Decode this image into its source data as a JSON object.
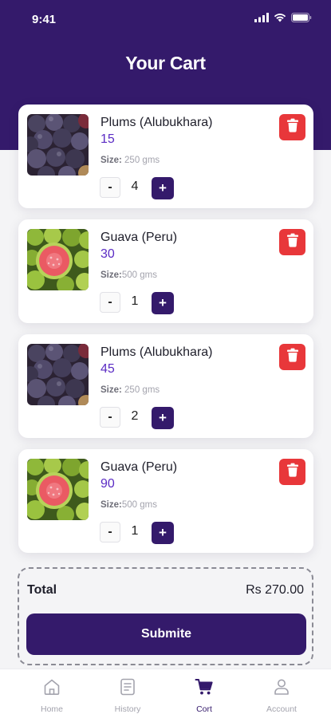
{
  "status_bar": {
    "time": "9:41"
  },
  "header": {
    "title": "Your Cart"
  },
  "cart_items": [
    {
      "name": "Plums (Alubukhara)",
      "price": "15",
      "size_label": "Size:",
      "size_value": " 250 gms",
      "quantity": "4",
      "image": "plums-image"
    },
    {
      "name": "Guava (Peru)",
      "price": "30",
      "size_label": "Size:",
      "size_value": "500 gms",
      "quantity": "1",
      "image": "guava-image"
    },
    {
      "name": "Plums (Alubukhara)",
      "price": "45",
      "size_label": "Size:",
      "size_value": " 250 gms",
      "quantity": "2",
      "image": "plums-image"
    },
    {
      "name": "Guava (Peru)",
      "price": "90",
      "size_label": "Size:",
      "size_value": "500 gms",
      "quantity": "1",
      "image": "guava-image"
    }
  ],
  "quantity_controls": {
    "minus": "-",
    "plus": "+"
  },
  "summary": {
    "total_label": "Total",
    "total_value": "Rs 270.00",
    "submit_label": "Submite"
  },
  "tab_bar": {
    "items": [
      {
        "label": "Home",
        "icon": "home-icon",
        "active": false
      },
      {
        "label": "History",
        "icon": "history-icon",
        "active": false
      },
      {
        "label": "Cort",
        "icon": "cart-icon",
        "active": true
      },
      {
        "label": "Account",
        "icon": "account-icon",
        "active": false
      }
    ]
  },
  "colors": {
    "brand": "#341a6b",
    "price": "#5b2cc4",
    "delete": "#e8373a",
    "background": "#f4f4f6"
  }
}
